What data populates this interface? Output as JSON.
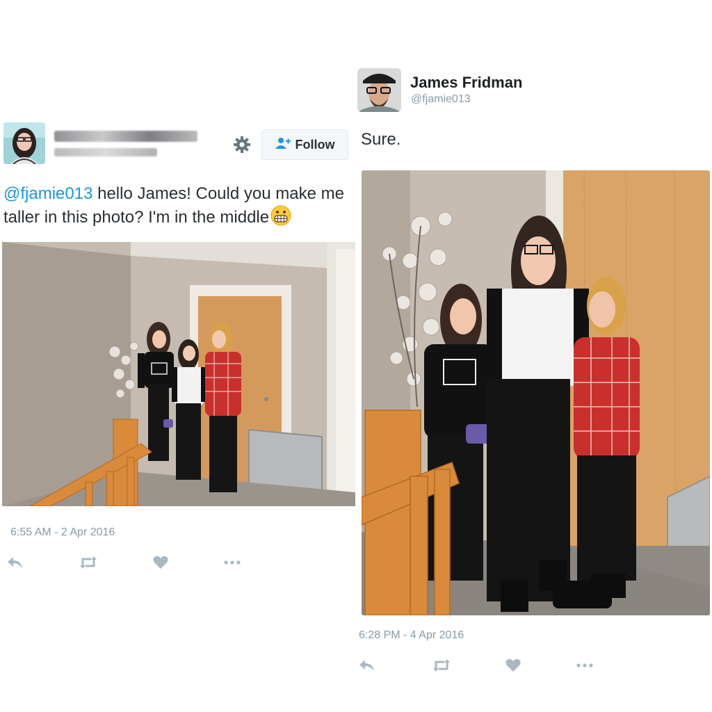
{
  "left_tweet": {
    "follow_label": "Follow",
    "mention": "@fjamie013",
    "text_line1": " hello James! Could you make me",
    "text_line2": "taller in this photo? I'm in the middle",
    "timestamp": "6:55 AM - 2 Apr 2016",
    "icons": [
      "avatar",
      "gear-icon",
      "add-user-icon",
      "grimacing-emoji-icon",
      "reply-icon",
      "retweet-icon",
      "like-icon",
      "more-icon"
    ]
  },
  "right_tweet": {
    "name": "James Fridman",
    "handle": "@fjamie013",
    "text": "Sure.",
    "timestamp": "6:28 PM - 4 Apr 2016",
    "icons": [
      "avatar",
      "reply-icon",
      "retweet-icon",
      "like-icon",
      "more-icon"
    ]
  },
  "colors": {
    "mention": "#1b95e0",
    "meta_gray": "#8899a6",
    "action_gray": "#aab8c2",
    "shirt_red": "#c9302c",
    "wall": "#c9bfb5",
    "door": "#d8a56a",
    "banister": "#d98a3a"
  }
}
